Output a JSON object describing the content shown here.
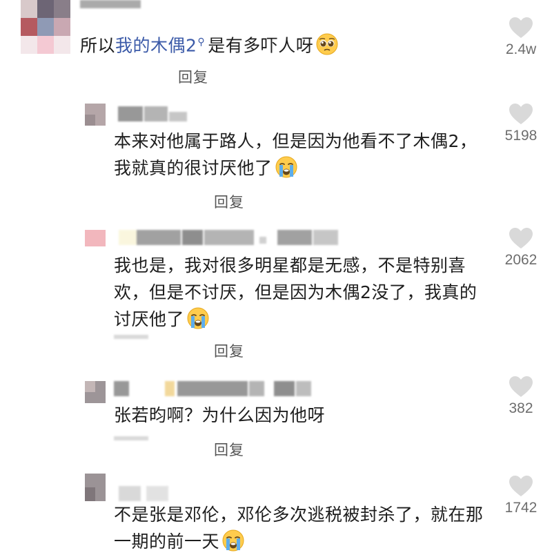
{
  "comments": [
    {
      "text_pre": "所以",
      "link": "我的木偶2",
      "text_post": "是有多吓人呀",
      "emoji": "pleading-face",
      "reply_label": "回复",
      "like_icon": "heart-icon",
      "likes": "2.4w"
    },
    {
      "text": "本来对他属于路人，但是因为他看不了木偶2，我就真的很讨厌他了",
      "emoji": "loudly-crying-face",
      "reply_label": "回复",
      "like_icon": "heart-icon",
      "likes": "5198"
    },
    {
      "text": "我也是，我对很多明星都是无感，不是特别喜欢，但是不讨厌，但是因为木偶2没了，我真的讨厌他了",
      "emoji": "loudly-crying-face",
      "reply_label": "回复",
      "like_icon": "heart-icon",
      "likes": "2062"
    },
    {
      "text": "张若昀啊？为什么因为他呀",
      "reply_label": "回复",
      "like_icon": "heart-icon",
      "likes": "382"
    },
    {
      "text": "不是张是邓伦，邓伦多次逃税被封杀了，就在那一期的前一天",
      "emoji": "loudly-crying-face",
      "like_icon": "heart-icon",
      "likes": "1742"
    }
  ],
  "colors": {
    "link": "#3b5aa8",
    "text": "#1e1e1e",
    "meta": "#6d6d6d",
    "heart": "#d9d9d9"
  }
}
